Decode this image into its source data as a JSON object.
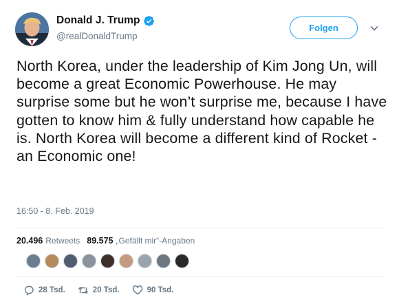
{
  "user": {
    "display_name": "Donald J. Trump",
    "handle": "@realDonaldTrump",
    "verified": true
  },
  "follow_button": {
    "label": "Folgen"
  },
  "tweet": {
    "text": "North Korea, under the leadership of Kim Jong Un, will become a great Economic Powerhouse. He may surprise some but he won’t surprise me, because I have gotten to know him & fully understand how capable he is. North Korea will become a different kind of Rocket - an Economic one!",
    "timestamp": "16:50 - 8. Feb. 2019"
  },
  "stats": {
    "retweets_count": "20.496",
    "retweets_label": "Retweets",
    "likes_count": "89.575",
    "likes_label": "„Gefällt mir“-Angaben"
  },
  "actions": {
    "replies": "28 Tsd.",
    "retweets": "20 Tsd.",
    "likes": "90 Tsd."
  },
  "colors": {
    "accent": "#1da1f2",
    "secondary_text": "#657786",
    "divider": "#e6ecf0"
  }
}
